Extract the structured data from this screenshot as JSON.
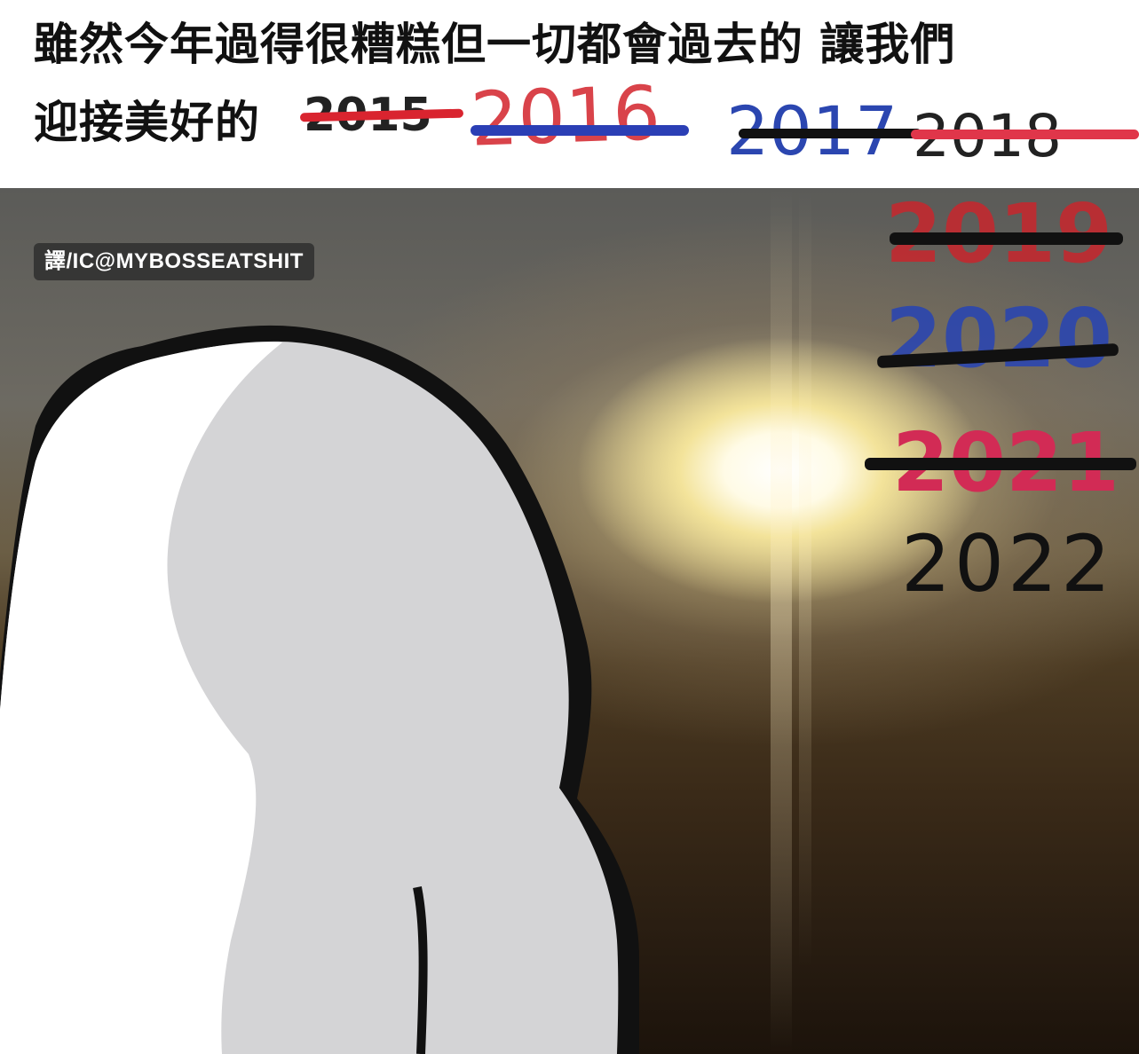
{
  "caption": {
    "line1": "雖然今年過得很糟糕但一切都會過去的 讓我們",
    "line2_prefix": "迎接美好的"
  },
  "years": [
    {
      "label": "2015",
      "color": "#222222",
      "strike_color": "#d9242f",
      "struck": true
    },
    {
      "label": "2016",
      "color": "#d9434a",
      "strike_color": "#2b3fb5",
      "struck": true
    },
    {
      "label": "2017",
      "color": "#2b46b0",
      "strike_color": "#111111",
      "struck": true
    },
    {
      "label": "2018",
      "color": "#222222",
      "strike_color": "#e0364a",
      "struck": true
    },
    {
      "label": "2019",
      "color": "#c8262d",
      "strike_color": "#111111",
      "struck": true
    },
    {
      "label": "2020",
      "color": "#2b46b0",
      "strike_color": "#111111",
      "struck": true
    },
    {
      "label": "2021",
      "color": "#d22b55",
      "strike_color": "#111111",
      "struck": true
    },
    {
      "label": "2022",
      "color": "#111111",
      "struck": false
    }
  ],
  "credit": "譯/IC@MYBOSSEATSHIT",
  "image": {
    "silhouette": "head-silhouette",
    "background": "sunrise"
  }
}
